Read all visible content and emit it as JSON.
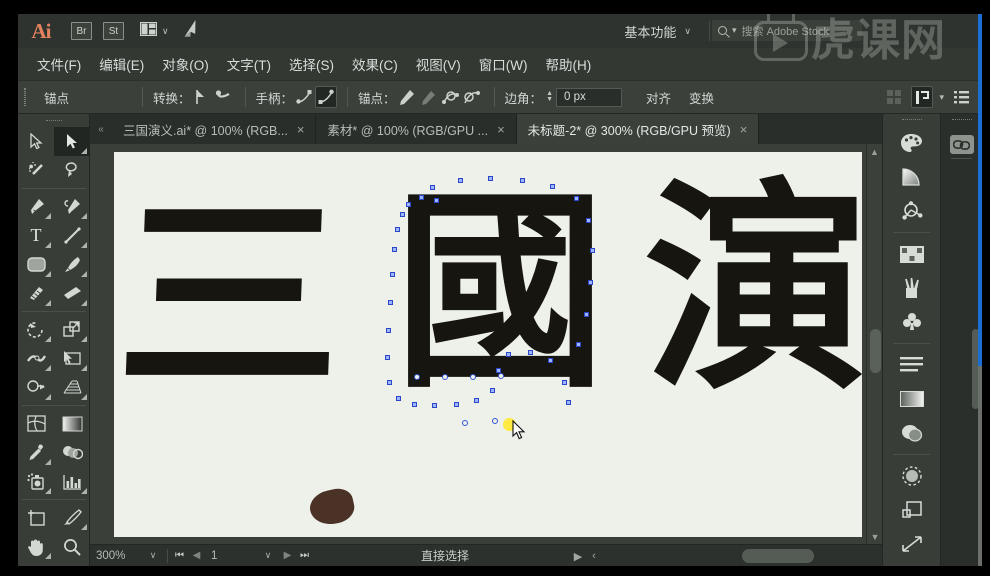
{
  "app": {
    "logo": "Ai",
    "quick_buttons": [
      {
        "name": "bridge",
        "label": "Br"
      },
      {
        "name": "stock",
        "label": "St"
      }
    ],
    "arrange_icon": "arrange-documents-icon",
    "chevron": "∨",
    "rocket_icon": "➤"
  },
  "workspace": {
    "label": "基本功能",
    "chevron": "∨"
  },
  "search": {
    "icon": "search-icon",
    "placeholder": "搜索 Adobe Stock"
  },
  "menubar": {
    "items": [
      {
        "label": "文件(F)"
      },
      {
        "label": "编辑(E)"
      },
      {
        "label": "对象(O)"
      },
      {
        "label": "文字(T)"
      },
      {
        "label": "选择(S)"
      },
      {
        "label": "效果(C)"
      },
      {
        "label": "视图(V)"
      },
      {
        "label": "窗口(W)"
      },
      {
        "label": "帮助(H)"
      }
    ]
  },
  "controlbar": {
    "context_label": "锚点",
    "convert_label": "转换：",
    "handles_label": "手柄：",
    "anchors_label": "锚点：",
    "corner_label": "边角：",
    "corner_value": "0  px",
    "align_label": "对齐",
    "transform_label": "变换",
    "icons": {
      "convert_to_corner": "convert-anchor-corner-icon",
      "convert_to_smooth": "convert-anchor-smooth-icon",
      "show_handles": "show-handles-icon",
      "hide_handles": "hide-handles-icon",
      "remove_anchor": "remove-anchor-icon",
      "connect_anchor": "connect-anchors-icon",
      "isolate_anchor": "isolate-selected-anchor-icon",
      "cut_path": "cut-path-at-anchor-icon",
      "grid": "grid-icon",
      "arrange": "arrange-icon",
      "menu": "panel-menu-icon"
    }
  },
  "tabs": [
    {
      "title": "三国演义.ai* @ 100% (RGB...",
      "active": false,
      "close": "×"
    },
    {
      "title": "素材* @ 100% (RGB/GPU ...",
      "active": false,
      "close": "×"
    },
    {
      "title": "未标题-2* @ 300% (RGB/GPU 预览)",
      "active": true,
      "close": "×"
    }
  ],
  "toolbar": {
    "tools": [
      {
        "name": "selection-tool",
        "glyph": "➤",
        "selected": false,
        "has_flyout": false
      },
      {
        "name": "direct-selection-tool",
        "glyph": "➤",
        "selected": true,
        "has_flyout": true
      },
      {
        "name": "magic-wand-tool",
        "glyph": "✨",
        "selected": false,
        "has_flyout": false
      },
      {
        "name": "lasso-tool",
        "glyph": "☄",
        "selected": false,
        "has_flyout": false
      },
      {
        "name": "pen-tool",
        "glyph": "✒",
        "selected": false,
        "has_flyout": true
      },
      {
        "name": "curvature-tool",
        "glyph": "✒",
        "selected": false,
        "has_flyout": true
      },
      {
        "name": "type-tool",
        "glyph": "T",
        "selected": false,
        "has_flyout": true
      },
      {
        "name": "line-segment-tool",
        "glyph": "╱",
        "selected": false,
        "has_flyout": true
      },
      {
        "name": "rectangle-tool",
        "glyph": "▢",
        "selected": false,
        "has_flyout": true
      },
      {
        "name": "paintbrush-tool",
        "glyph": "✎",
        "selected": false,
        "has_flyout": true
      },
      {
        "name": "blob-brush-tool",
        "glyph": "✐",
        "selected": false,
        "has_flyout": true
      },
      {
        "name": "eraser-tool",
        "glyph": "▱",
        "selected": false,
        "has_flyout": true
      },
      {
        "name": "rotate-tool",
        "glyph": "↺",
        "selected": false,
        "has_flyout": true
      },
      {
        "name": "scale-tool",
        "glyph": "⤡",
        "selected": false,
        "has_flyout": true
      },
      {
        "name": "width-tool",
        "glyph": "≈",
        "selected": false,
        "has_flyout": true
      },
      {
        "name": "free-transform-tool",
        "glyph": "⧉",
        "selected": false,
        "has_flyout": true
      },
      {
        "name": "shape-builder-tool",
        "glyph": "⊛",
        "selected": false,
        "has_flyout": true
      },
      {
        "name": "perspective-grid-tool",
        "glyph": "◤",
        "selected": false,
        "has_flyout": true
      },
      {
        "name": "mesh-tool",
        "glyph": "⌗",
        "selected": false,
        "has_flyout": false
      },
      {
        "name": "gradient-tool",
        "glyph": "■",
        "selected": false,
        "has_flyout": false
      },
      {
        "name": "eyedropper-tool",
        "glyph": "⚗",
        "selected": false,
        "has_flyout": true
      },
      {
        "name": "blend-tool",
        "glyph": "◐",
        "selected": false,
        "has_flyout": false
      },
      {
        "name": "symbol-sprayer-tool",
        "glyph": "☘",
        "selected": false,
        "has_flyout": true
      },
      {
        "name": "column-graph-tool",
        "glyph": "█",
        "selected": false,
        "has_flyout": true
      },
      {
        "name": "artboard-tool",
        "glyph": "⬚",
        "selected": false,
        "has_flyout": false
      },
      {
        "name": "slice-tool",
        "glyph": "✂",
        "selected": false,
        "has_flyout": true
      },
      {
        "name": "hand-tool",
        "glyph": "✋",
        "selected": false,
        "has_flyout": true
      },
      {
        "name": "zoom-tool",
        "glyph": "⚲",
        "selected": false,
        "has_flyout": false
      }
    ]
  },
  "canvas": {
    "background": "#3a3f3a",
    "artboard_color": "#eef0ea",
    "ink_color": "#17150f",
    "tint_color": "#4b3226",
    "glyphs": [
      {
        "name": "glyph-san",
        "char": "三"
      },
      {
        "name": "glyph-guo",
        "char": "國"
      },
      {
        "name": "glyph-yan",
        "char": "演"
      }
    ],
    "selection": {
      "anchor_color": "#3355d8",
      "highlight_color": "#ffe93a",
      "selected_glyph": "國"
    }
  },
  "statusbar": {
    "zoom_value": "300%",
    "zoom_chevron": "∨",
    "first_page": "⏮",
    "prev_page": "◀",
    "page_value": "1",
    "page_chevron": "∨",
    "next_page": "▶",
    "last_page": "⏭",
    "status_text": "直接选择",
    "play_icon": "▶",
    "scroll_left": "‹",
    "scroll_right": "›"
  },
  "dock": {
    "items": [
      {
        "name": "color-panel-icon",
        "glyph": "◕"
      },
      {
        "name": "gradient-panel-icon",
        "glyph": "◥"
      },
      {
        "name": "stroke-panel-icon",
        "glyph": "❂"
      },
      {
        "name": "swatches-panel-icon",
        "glyph": "▓"
      },
      {
        "name": "brushes-panel-icon",
        "glyph": "⚘"
      },
      {
        "name": "symbols-panel-icon",
        "glyph": "♣"
      },
      {
        "name": "paragraph-panel-icon",
        "glyph": "☰"
      },
      {
        "name": "gradient-strip-icon",
        "glyph": "▬"
      },
      {
        "name": "transparency-panel-icon",
        "glyph": "◍"
      },
      {
        "name": "appearance-panel-icon",
        "glyph": "◌"
      },
      {
        "name": "layers-panel-icon",
        "glyph": "❐"
      },
      {
        "name": "artboards-panel-icon",
        "glyph": "↗"
      }
    ],
    "creative_cloud_icon": "∞"
  },
  "watermark": {
    "text": "虎课网",
    "logo": "play-button-logo"
  }
}
